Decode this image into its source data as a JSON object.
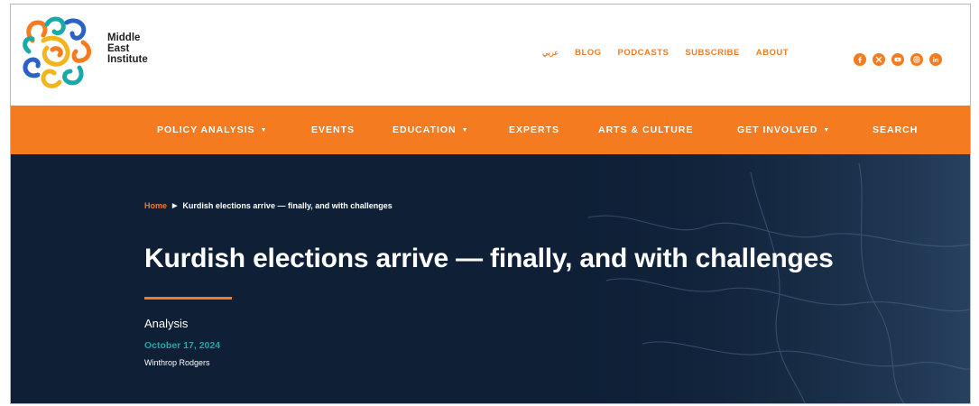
{
  "site": {
    "name_lines": [
      "Middle",
      "East",
      "Institute"
    ]
  },
  "utility_nav": {
    "arabic": "عربي",
    "items": [
      "BLOG",
      "PODCASTS",
      "SUBSCRIBE",
      "ABOUT"
    ]
  },
  "social": [
    "facebook-icon",
    "x-icon",
    "youtube-icon",
    "instagram-icon",
    "linkedin-icon"
  ],
  "main_nav": {
    "items": [
      {
        "label": "POLICY ANALYSIS",
        "dropdown": true
      },
      {
        "label": "EVENTS",
        "dropdown": false
      },
      {
        "label": "EDUCATION",
        "dropdown": true
      },
      {
        "label": "EXPERTS",
        "dropdown": false
      },
      {
        "label": "ARTS & CULTURE",
        "dropdown": false
      },
      {
        "label": "GET INVOLVED",
        "dropdown": true
      },
      {
        "label": "SEARCH",
        "dropdown": false
      }
    ],
    "caret": "▼"
  },
  "article": {
    "breadcrumb_home": "Home",
    "breadcrumb_sep": "▶",
    "breadcrumb_current": "Kurdish elections arrive — finally, and with challenges",
    "title": "Kurdish elections arrive — finally, and with challenges",
    "type": "Analysis",
    "date": "October 17, 2024",
    "author": "Winthrop Rodgers"
  },
  "colors": {
    "accent": "#f47b20",
    "hero_bg": "#0e1f36",
    "date": "#1aa9a9"
  }
}
